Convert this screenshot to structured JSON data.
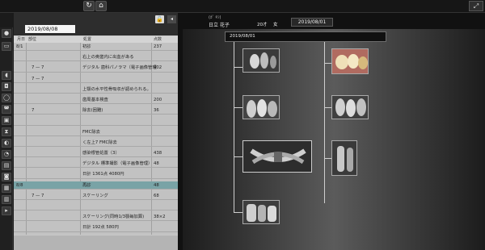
{
  "header": {
    "back_label": "↻",
    "home_label": "⌂",
    "expand_label": "⤢"
  },
  "left_panel": {
    "date": "2019/08/08",
    "lock_icon": "unlock-icon",
    "collapse_label": "◂",
    "columns": [
      "月日",
      "部位",
      "処置",
      "点数"
    ],
    "rows": [
      {
        "date": "8/1",
        "site": "",
        "treatment": "初診",
        "points": "237"
      },
      {
        "date": "",
        "site": "",
        "treatment": "右上の奥歯内に出血がある",
        "points": ""
      },
      {
        "date": "",
        "site": "7 — 7",
        "treatment": "デジタル 歯科パノラマ（電子画像管理",
        "points": "402"
      },
      {
        "date": "",
        "site": "7 — 7",
        "treatment": "",
        "points": ""
      },
      {
        "date": "",
        "site": "",
        "treatment": "上顎の水平性骨吸収が認められる。",
        "points": ""
      },
      {
        "date": "",
        "site": "",
        "treatment": "歯周基本検査",
        "points": "200"
      },
      {
        "date": "",
        "site": "7",
        "treatment": "除去(困難)",
        "points": "36"
      },
      {
        "date": "",
        "site": "",
        "treatment": "",
        "points": ""
      },
      {
        "date": "",
        "site": "",
        "treatment": "FMC除去",
        "points": ""
      },
      {
        "date": "",
        "site": "",
        "treatment": "く左上7 FMC除去",
        "points": ""
      },
      {
        "date": "",
        "site": "",
        "treatment": "感染根管処置（3）",
        "points": "438"
      },
      {
        "date": "",
        "site": "",
        "treatment": "デジタル 標準撮影（電子画像管理）",
        "points": "48"
      },
      {
        "date": "",
        "site": "",
        "treatment": "日計 1361点 4080円",
        "points": ""
      },
      {
        "date": "8/8",
        "site": "",
        "treatment": "再診",
        "points": "48",
        "selected": true
      },
      {
        "date": "",
        "site": "7 — 7",
        "treatment": "スケーリング",
        "points": "68"
      },
      {
        "date": "",
        "site": "",
        "treatment": "",
        "points": ""
      },
      {
        "date": "",
        "site": "",
        "treatment": "スケーリング(同時1/3顎毎加算)",
        "points": "38×2"
      },
      {
        "date": "",
        "site": "",
        "treatment": "日計 192点 580円",
        "points": ""
      }
    ]
  },
  "viewer": {
    "patient_id": "(ｶﾞ ｷｼ)",
    "patient_name": "日立 花子",
    "age": "20才",
    "sex": "女",
    "date_label": "2019/08/01",
    "group_title": "2019/08/01",
    "colors": {
      "accent": "#79a3a6"
    }
  }
}
